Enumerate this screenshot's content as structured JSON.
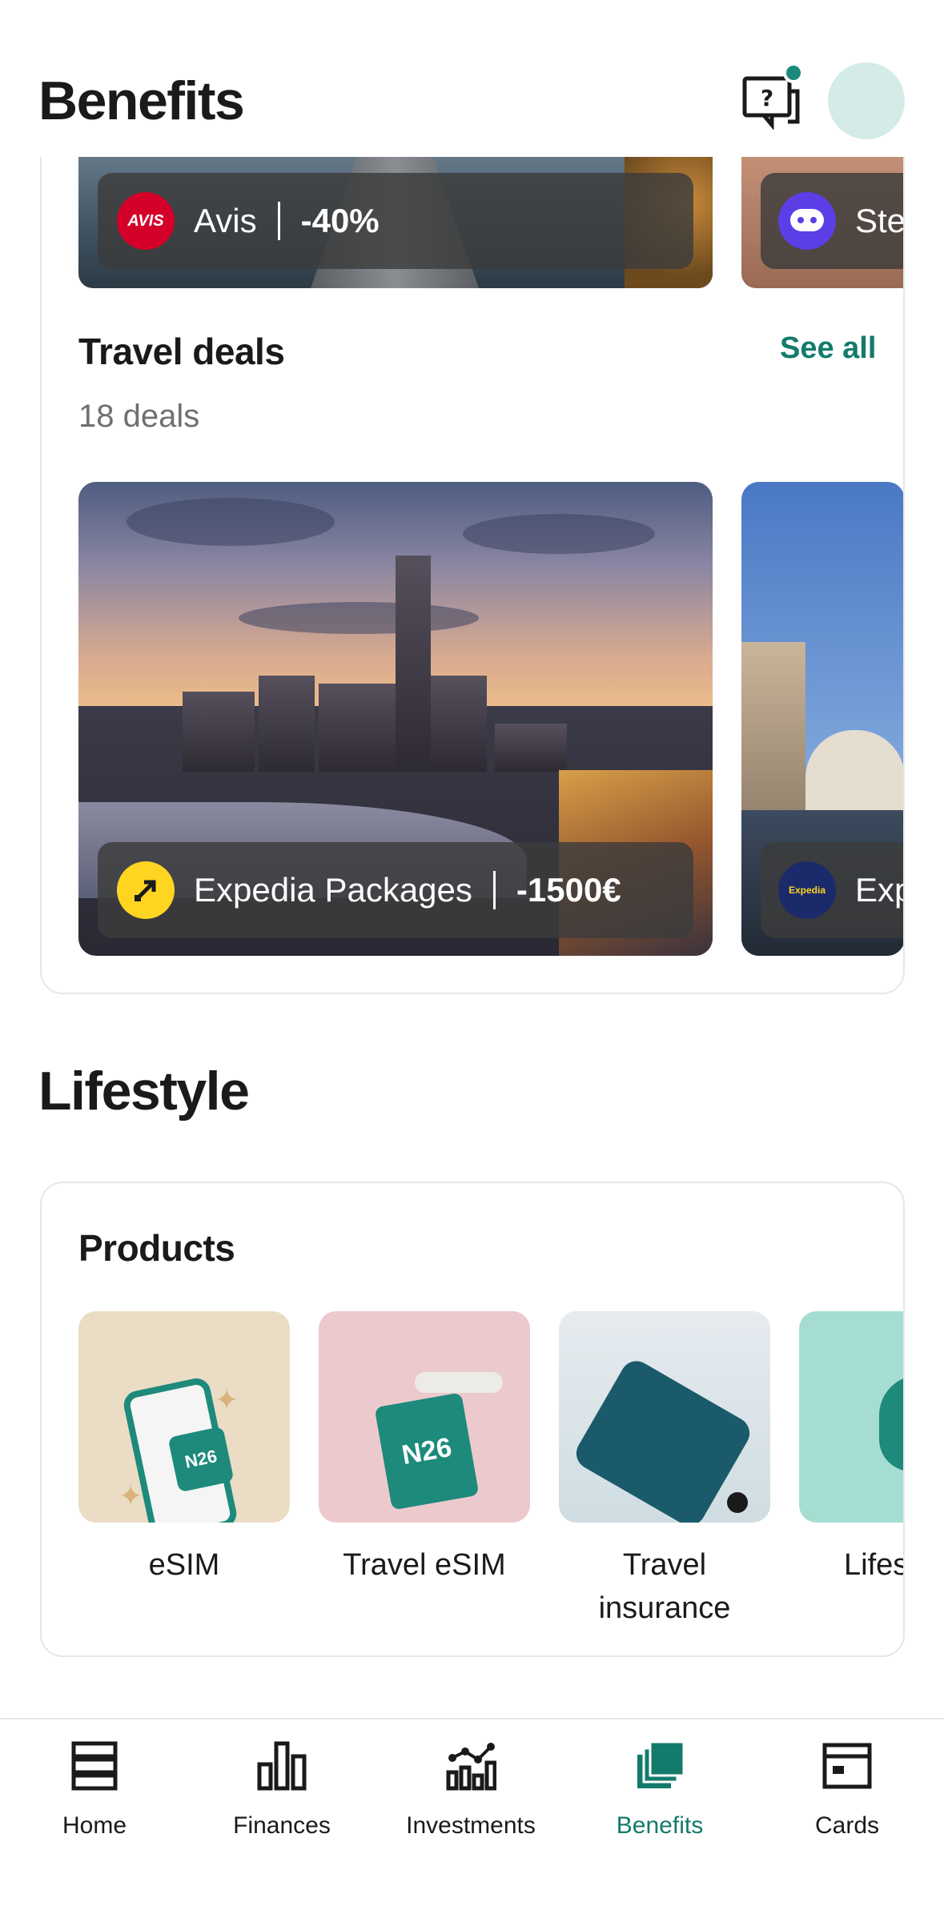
{
  "header": {
    "title": "Benefits"
  },
  "top_carousel": {
    "items": [
      {
        "brand": "Avis",
        "logo_text": "AVIS",
        "discount": "-40%"
      },
      {
        "brand": "Ste",
        "logo_text": ""
      }
    ]
  },
  "travel_deals": {
    "title": "Travel deals",
    "see_all_label": "See all",
    "count_label": "18 deals",
    "deals": [
      {
        "brand": "Expedia Packages",
        "discount": "-1500€"
      },
      {
        "brand": "Exp",
        "logo_text": "Expedia"
      }
    ]
  },
  "lifestyle": {
    "title": "Lifestyle",
    "products_title": "Products",
    "products": [
      {
        "label": "eSIM",
        "chip_text": "N26"
      },
      {
        "label": "Travel eSIM",
        "chip_text": "N26"
      },
      {
        "label": "Travel insurance"
      },
      {
        "label": "Lifes insur"
      }
    ]
  },
  "tabbar": {
    "active": "Benefits",
    "accent": "#137a6c",
    "tabs": [
      {
        "label": "Home",
        "icon": "home-icon"
      },
      {
        "label": "Finances",
        "icon": "bar-chart-icon"
      },
      {
        "label": "Investments",
        "icon": "investments-icon"
      },
      {
        "label": "Benefits",
        "icon": "benefits-icon"
      },
      {
        "label": "Cards",
        "icon": "card-icon"
      }
    ]
  }
}
